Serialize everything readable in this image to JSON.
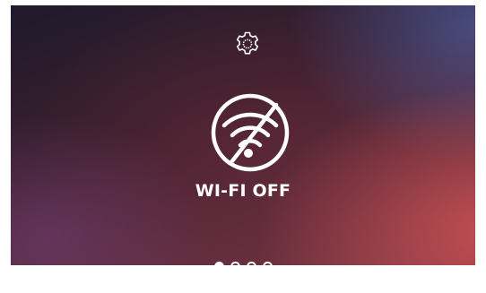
{
  "header": {
    "settings_icon": "gear-icon"
  },
  "status": {
    "icon": "wifi-off-icon",
    "label": "WI-FI OFF"
  },
  "pager": {
    "total_pages": 4,
    "active_page": 1
  }
}
